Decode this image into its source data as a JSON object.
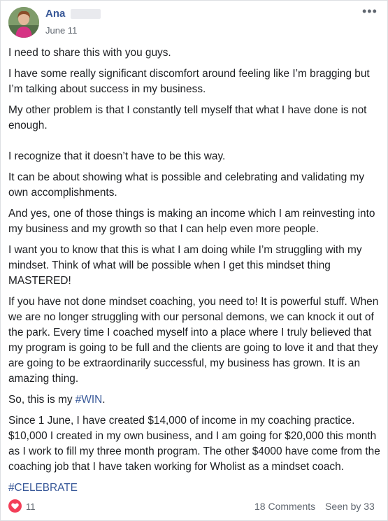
{
  "post": {
    "author": "Ana",
    "date": "June 11",
    "more_label": "•••",
    "paragraphs": [
      "I need to share this with you guys.",
      "I have some really significant discomfort around feeling like I’m bragging but I’m talking about success in my business.",
      "My other problem is that I constantly tell myself that what I have done is not enough.",
      "I recognize that it doesn’t have to be this way.",
      "It can be about showing what is possible and celebrating and validating my own accomplishments.",
      "And yes, one of those things is making an income which I am reinvesting into my business and my growth so that I can help even more people.",
      "I want you to know that this is what I am doing while I’m struggling with my mindset. Think of what will be possible when I get this mindset thing MASTERED!",
      "If you have not done mindset coaching, you need to! It is powerful stuff. When we are no longer struggling with our personal demons, we can knock it out of the park. Every time I coached myself into a place where I truly believed that my program is going to be full and the clients are going to love it and that they are going to be extraordinarily successful, my business has grown. It is an amazing thing.",
      "So, this is my ",
      "Since 1 June, I have created $14,000 of income in my coaching practice. $10,000 I created in my own business, and I am going for $20,000 this month as I work to fill my three month program. The other $4000 have come from the coaching job that I have taken working for Wholist as a mindset coach."
    ],
    "win_tag": "#WIN",
    "win_suffix": ".",
    "celebrate_tag": "#CELEBRATE"
  },
  "footer": {
    "reaction_count": "11",
    "comments": "18 Comments",
    "seen": "Seen by 33"
  },
  "colors": {
    "link": "#385898",
    "heart": "#f33e58",
    "meta": "#606770"
  }
}
